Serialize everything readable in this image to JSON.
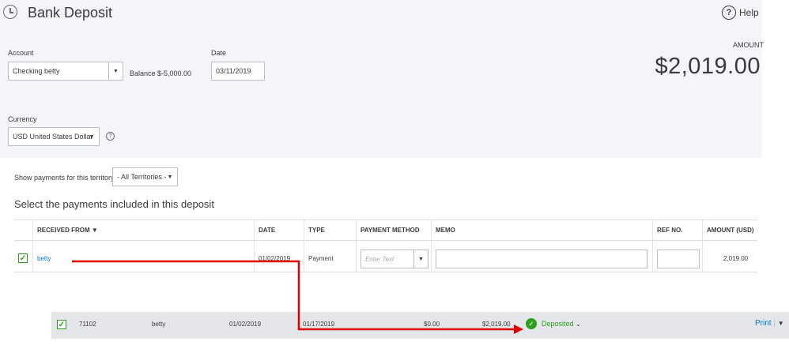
{
  "header": {
    "title": "Bank Deposit",
    "help_label": "Help"
  },
  "form": {
    "account_label": "Account",
    "account_value": "Checking betty",
    "balance_text": "Balance $-5,000.00",
    "date_label": "Date",
    "date_value": "03/11/2019",
    "currency_label": "Currency",
    "currency_value": "USD United States Dollar"
  },
  "amount": {
    "label": "AMOUNT",
    "value": "$2,019.00"
  },
  "territory": {
    "label": "Show payments for this territory:",
    "value": "- All Territories -"
  },
  "payments": {
    "title": "Select the payments included in this deposit",
    "columns": [
      "RECEIVED FROM ▼",
      "DATE",
      "TYPE",
      "PAYMENT METHOD",
      "MEMO",
      "REF NO.",
      "AMOUNT (USD)"
    ],
    "rows": [
      {
        "received_from": "betty",
        "date": "01/02/2019",
        "type": "Payment",
        "payment_method_placeholder": "Enter Text",
        "memo": "",
        "ref_no": "",
        "amount": "2,019.00",
        "checked": true
      }
    ]
  },
  "register_row": {
    "number": "71102",
    "payee": "betty",
    "date": "01/02/2019",
    "deposit_date": "01/17/2019",
    "payment": "$0.00",
    "deposit": "$2,019.00",
    "status": "Deposited",
    "print_label": "Print"
  },
  "colors": {
    "accent_green": "#2ca01c",
    "link_blue": "#0077c5",
    "arrow_red": "#e00000"
  },
  "icons": [
    "history-icon",
    "help-circle-icon",
    "checkmark-icon",
    "dropdown-caret-icon",
    "deposited-check-icon"
  ]
}
